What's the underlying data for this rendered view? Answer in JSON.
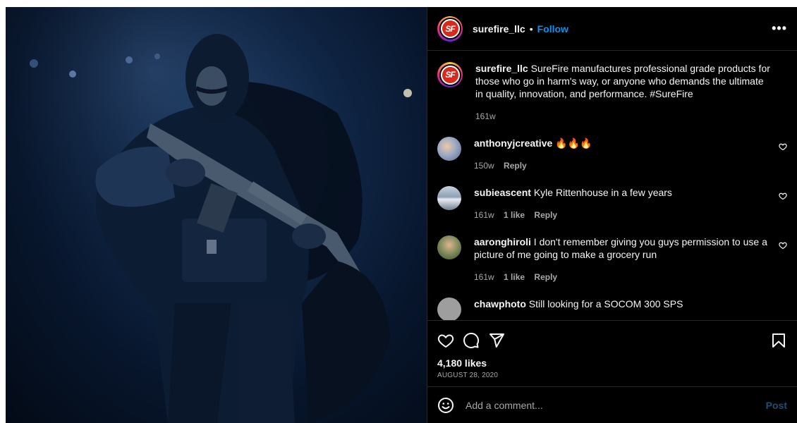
{
  "post": {
    "username": "surefire_llc",
    "follow_label": "Follow",
    "separator": "•",
    "more_label": "•••",
    "avatar_text": "SF"
  },
  "caption": {
    "username": "surefire_llc",
    "text": "SureFire manufactures professional grade products for those who go in harm's way, or anyone who demands the ultimate in quality, innovation, and performance. #SureFire",
    "age": "161w"
  },
  "comments": [
    {
      "username": "anthonyjcreative",
      "text": "🔥🔥🔥",
      "age": "150w",
      "likes": "",
      "reply": "Reply"
    },
    {
      "username": "subieascent",
      "text": "Kyle Rittenhouse in a few years",
      "age": "161w",
      "likes": "1 like",
      "reply": "Reply"
    },
    {
      "username": "aaronghiroli",
      "text": "I don't remember giving you guys permission to use a picture of me going to make a grocery run",
      "age": "161w",
      "likes": "1 like",
      "reply": "Reply"
    },
    {
      "username": "chawphoto",
      "text": "Still looking for a SOCOM 300 SPS"
    }
  ],
  "stats": {
    "likes": "4,180 likes",
    "date": "AUGUST 28, 2020"
  },
  "composer": {
    "placeholder": "Add a comment...",
    "post_label": "Post"
  },
  "icons": {
    "like": "heart-icon",
    "comment": "comment-bubble-icon",
    "share": "paper-plane-icon",
    "save": "bookmark-icon",
    "emoji": "smiley-icon",
    "more": "more-options-icon"
  },
  "colors": {
    "background": "#000000",
    "text": "#f5f5f5",
    "muted": "#a8a8a8",
    "link": "#0095f6",
    "post_disabled": "#1b4f7a",
    "brand_red": "#d62a1e"
  }
}
